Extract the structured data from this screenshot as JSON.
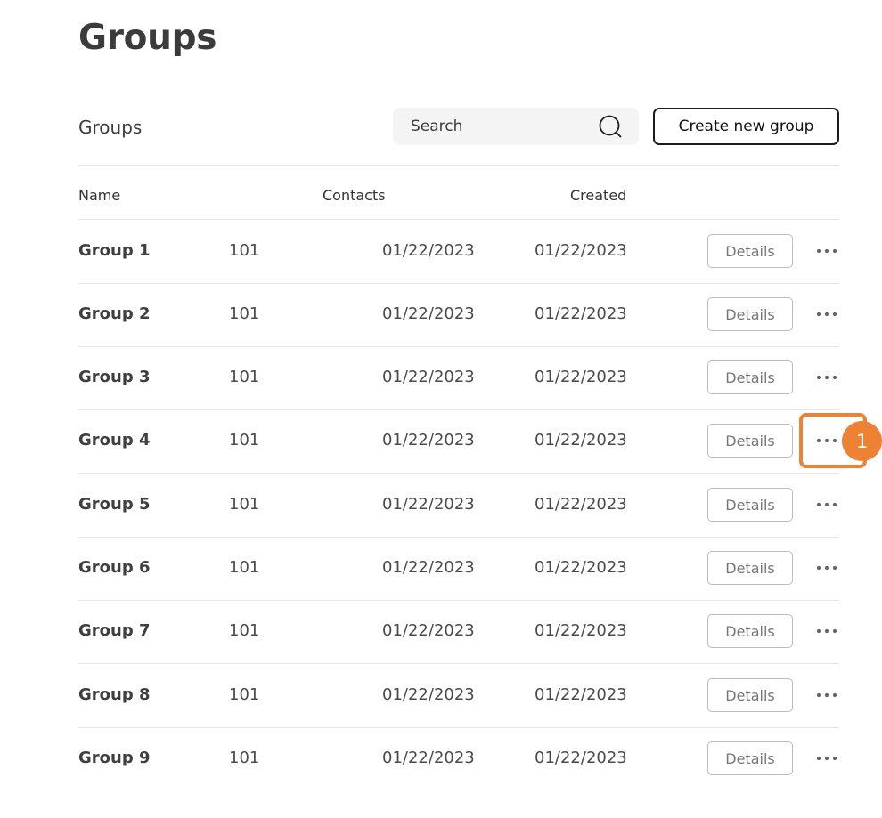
{
  "page": {
    "title": "Groups"
  },
  "section": {
    "title": "Groups"
  },
  "search": {
    "placeholder": "Search",
    "value": ""
  },
  "toolbar": {
    "create_label": "Create new group"
  },
  "table": {
    "columns": {
      "name": "Name",
      "contacts": "Contacts",
      "created": "Created"
    },
    "rows": [
      {
        "name": "Group 1",
        "contacts": "101",
        "date_1": "01/22/2023",
        "date_2": "01/22/2023",
        "details_label": "Details"
      },
      {
        "name": "Group 2",
        "contacts": "101",
        "date_1": "01/22/2023",
        "date_2": "01/22/2023",
        "details_label": "Details"
      },
      {
        "name": "Group 3",
        "contacts": "101",
        "date_1": "01/22/2023",
        "date_2": "01/22/2023",
        "details_label": "Details"
      },
      {
        "name": "Group 4",
        "contacts": "101",
        "date_1": "01/22/2023",
        "date_2": "01/22/2023",
        "details_label": "Details"
      },
      {
        "name": "Group 5",
        "contacts": "101",
        "date_1": "01/22/2023",
        "date_2": "01/22/2023",
        "details_label": "Details"
      },
      {
        "name": "Group 6",
        "contacts": "101",
        "date_1": "01/22/2023",
        "date_2": "01/22/2023",
        "details_label": "Details"
      },
      {
        "name": "Group 7",
        "contacts": "101",
        "date_1": "01/22/2023",
        "date_2": "01/22/2023",
        "details_label": "Details"
      },
      {
        "name": "Group 8",
        "contacts": "101",
        "date_1": "01/22/2023",
        "date_2": "01/22/2023",
        "details_label": "Details"
      },
      {
        "name": "Group 9",
        "contacts": "101",
        "date_1": "01/22/2023",
        "date_2": "01/22/2023",
        "details_label": "Details"
      }
    ]
  },
  "annotation": {
    "label": "1",
    "color": "#ee8232"
  },
  "icons": {
    "search": "search-icon",
    "more": "more-horizontal-icon"
  }
}
